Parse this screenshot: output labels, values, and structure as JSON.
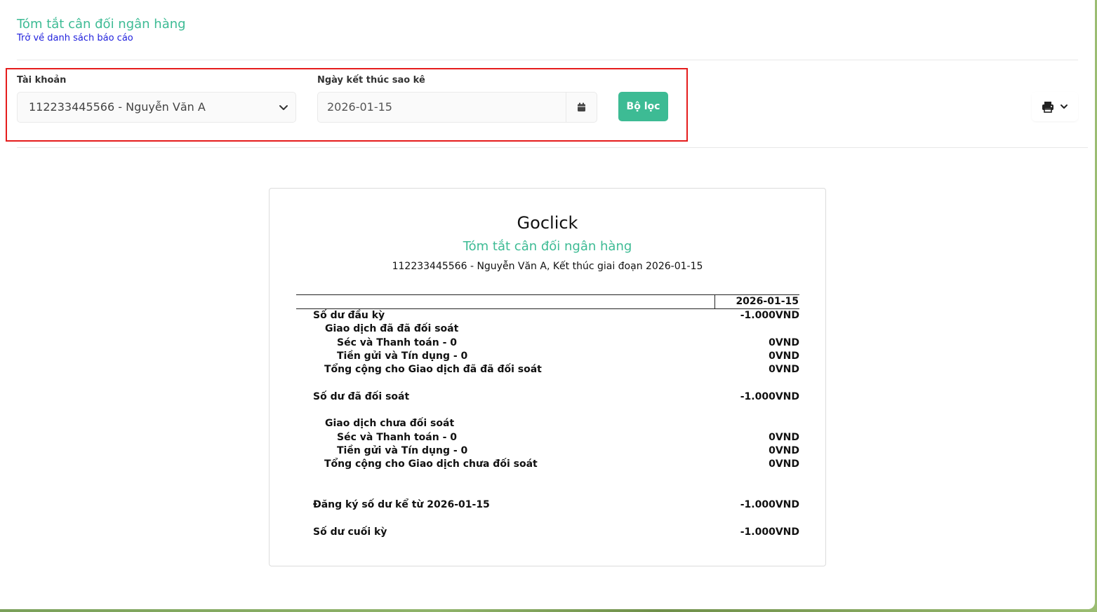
{
  "header": {
    "title": "Tóm tắt cân đối ngân hàng",
    "back_link": "Trở về danh sách báo cáo"
  },
  "filters": {
    "account_label": "Tài khoản",
    "account_value": "112233445566 - Nguyễn Văn A",
    "date_label": "Ngày kết thúc sao kê",
    "date_value": "2026-01-15",
    "filter_button": "Bộ lọc"
  },
  "colors": {
    "accent": "#3dbb94",
    "highlight": "#e51c1c",
    "link": "#2222dd"
  },
  "report": {
    "company": "Goclick",
    "title": "Tóm tắt cân đối ngân hàng",
    "subtitle": "112233445566 - Nguyễn Văn A, Kết thúc giai đoạn 2026-01-15",
    "column_header": "2026-01-15",
    "rows": [
      {
        "label": "Số dư đầu kỳ",
        "value": "-1.000VND"
      },
      {
        "label": "Giao dịch đã đã đối soát",
        "value": ""
      },
      {
        "label": "Séc và Thanh toán - 0",
        "value": "0VND"
      },
      {
        "label": "Tiền gửi và Tín dụng - 0",
        "value": "0VND"
      },
      {
        "label": "Tổng cộng cho Giao dịch đã đã đối soát",
        "value": "0VND"
      },
      {
        "label": "Số dư đã đối soát",
        "value": "-1.000VND"
      },
      {
        "label": "Giao dịch chưa đối soát",
        "value": ""
      },
      {
        "label": "Séc và Thanh toán - 0",
        "value": "0VND"
      },
      {
        "label": "Tiền gửi và Tín dụng - 0",
        "value": "0VND"
      },
      {
        "label": "Tổng cộng cho Giao dịch chưa đối soát",
        "value": "0VND"
      },
      {
        "label": "Đăng ký số dư kể từ 2026-01-15",
        "value": "-1.000VND"
      },
      {
        "label": "Số dư cuối kỳ",
        "value": "-1.000VND"
      }
    ]
  }
}
